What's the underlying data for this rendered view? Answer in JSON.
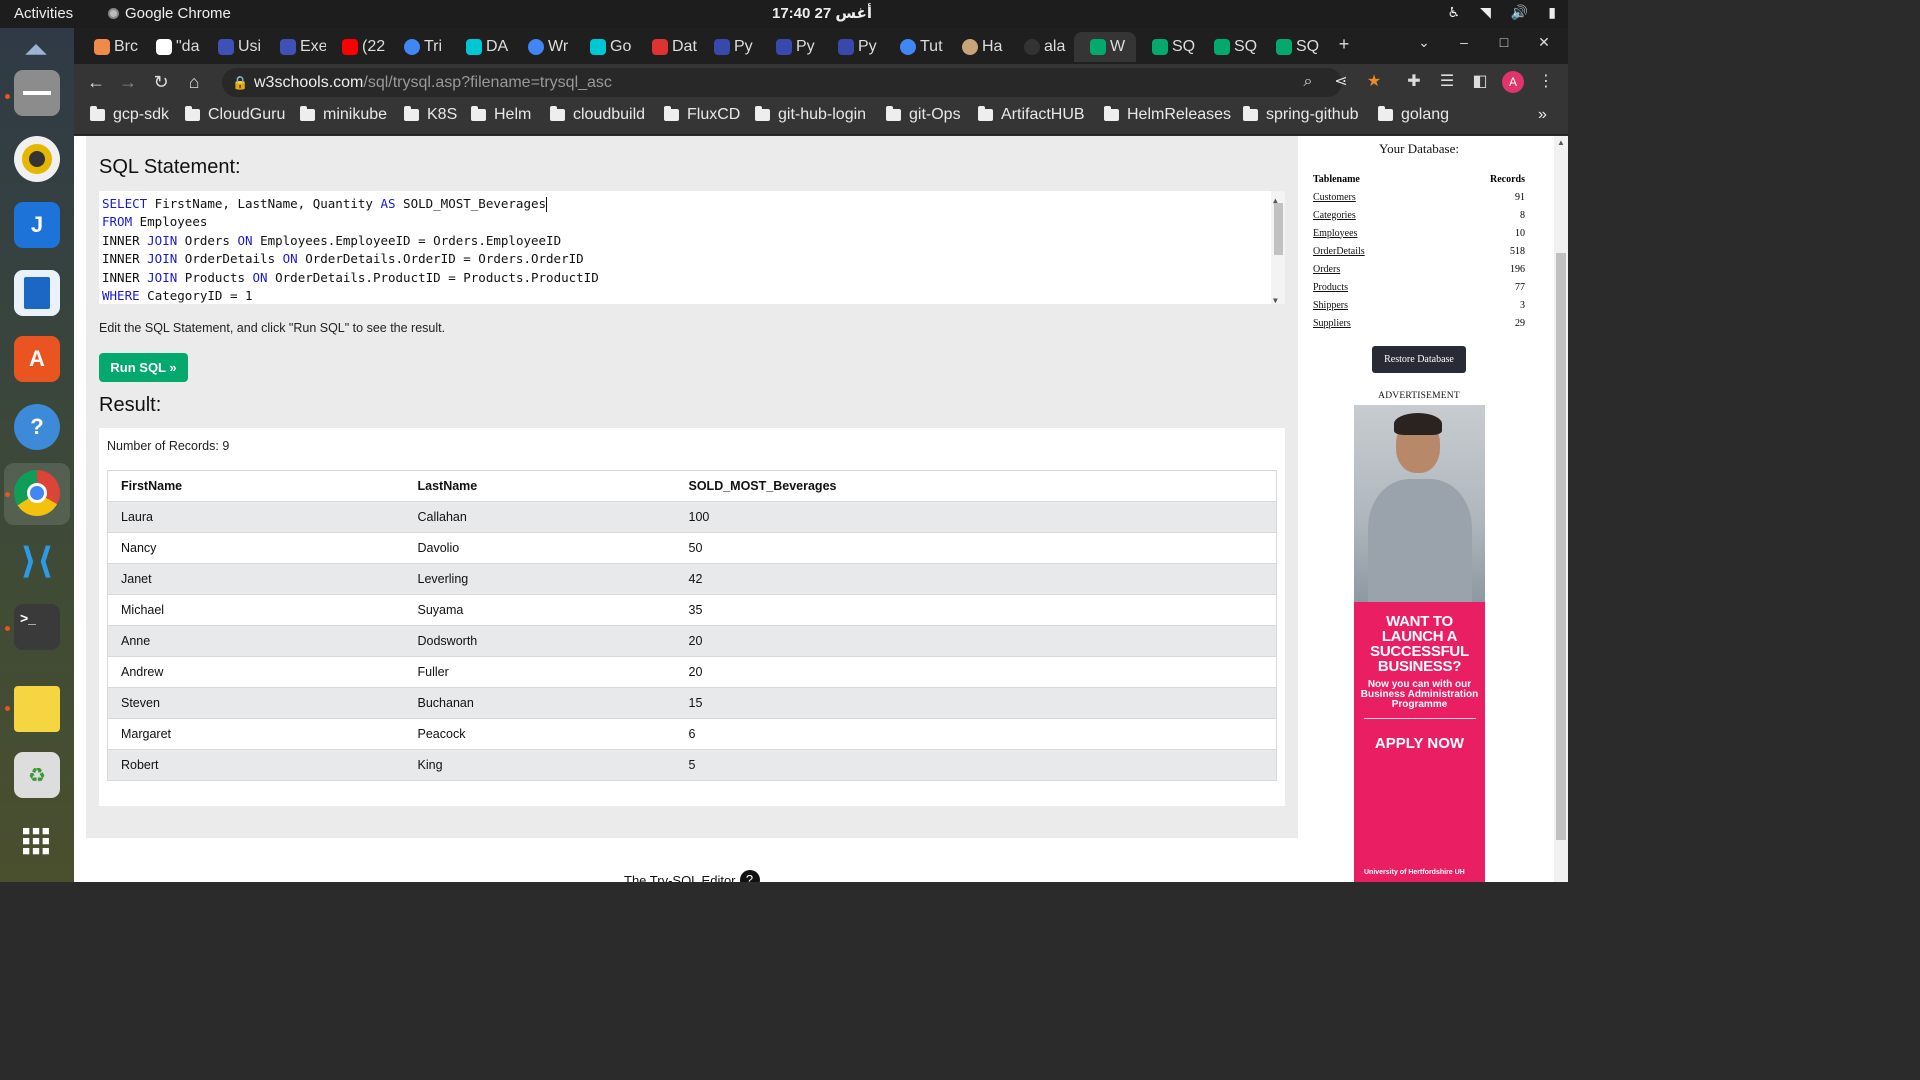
{
  "system": {
    "activities": "Activities",
    "app_name": "Google Chrome",
    "clock": "17:40  27 أغس",
    "tray_icons": [
      "accessibility-icon",
      "wifi-icon",
      "volume-icon",
      "battery-icon"
    ]
  },
  "dock": {
    "apps": [
      "ubuntu-logo",
      "files",
      "rhythmbox",
      "joplin",
      "libreoffice-writer",
      "app-center",
      "help",
      "google-chrome",
      "vs-code",
      "terminal",
      "sticky-notes",
      "trash",
      "show-apps"
    ]
  },
  "browser": {
    "tabs": [
      "Brc",
      "\"da",
      "Usi",
      "Exe",
      "(22",
      "Tri",
      "DA",
      "Wr",
      "Go",
      "Dat",
      "Py",
      "Py",
      "Py",
      "Tut",
      "Ha",
      "ala",
      "W",
      "SQ",
      "SQ",
      "SQ"
    ],
    "new_tab": "+",
    "url_host": "w3schools.com",
    "url_path": "/sql/trysql.asp?filename=trysql_asc",
    "avatar_letter": "A",
    "bookmarks": [
      "gcp-sdk",
      "CloudGuru",
      "minikube",
      "K8S",
      "Helm",
      "cloudbuild",
      "FluxCD",
      "git-hub-login",
      "git-Ops",
      "ArtifactHUB",
      "HelmReleases",
      "spring-github",
      "golang"
    ],
    "bookmarks_more": "»"
  },
  "editor": {
    "heading": "SQL Statement:",
    "lines": [
      {
        "kw": "SELECT",
        "rest": " FirstName, LastName, Quantity "
      },
      {
        "kw": "FROM",
        "rest": " Employees"
      },
      {
        "pre": "INNER ",
        "kw": "JOIN",
        "rest": " Orders "
      },
      {
        "pre": "INNER ",
        "kw": "JOIN",
        "rest": " OrderDetails "
      },
      {
        "pre": "INNER ",
        "kw": "JOIN",
        "rest": " Products "
      },
      {
        "kw": "WHERE",
        "rest": " CategoryID = 1"
      }
    ],
    "line1_as": "AS",
    "line1_tail": " SOLD_MOST_Beverages",
    "on_kw": "ON",
    "on_tails": [
      " Employees.EmployeeID = Orders.EmployeeID",
      " OrderDetails.OrderID = Orders.OrderID",
      " OrderDetails.ProductID = Products.ProductID"
    ],
    "hint": "Edit the SQL Statement, and click \"Run SQL\" to see the result.",
    "run_label": "Run SQL »"
  },
  "result": {
    "heading": "Result:",
    "count_text": "Number of Records: 9",
    "columns": [
      "FirstName",
      "LastName",
      "SOLD_MOST_Beverages"
    ],
    "rows": [
      [
        "Laura",
        "Callahan",
        "100"
      ],
      [
        "Nancy",
        "Davolio",
        "50"
      ],
      [
        "Janet",
        "Leverling",
        "42"
      ],
      [
        "Michael",
        "Suyama",
        "35"
      ],
      [
        "Anne",
        "Dodsworth",
        "20"
      ],
      [
        "Andrew",
        "Fuller",
        "20"
      ],
      [
        "Steven",
        "Buchanan",
        "15"
      ],
      [
        "Margaret",
        "Peacock",
        "6"
      ],
      [
        "Robert",
        "King",
        "5"
      ]
    ]
  },
  "footer": {
    "text": "The Try-SQL Editor",
    "help_glyph": "?"
  },
  "database": {
    "title": "Your Database:",
    "col_table": "Tablename",
    "col_records": "Records",
    "tables": [
      {
        "name": "Customers",
        "records": "91"
      },
      {
        "name": "Categories",
        "records": "8"
      },
      {
        "name": "Employees",
        "records": "10"
      },
      {
        "name": "OrderDetails",
        "records": "518"
      },
      {
        "name": "Orders",
        "records": "196"
      },
      {
        "name": "Products",
        "records": "77"
      },
      {
        "name": "Shippers",
        "records": "3"
      },
      {
        "name": "Suppliers",
        "records": "29"
      }
    ],
    "restore_label": "Restore Database"
  },
  "ad": {
    "label": "ADVERTISEMENT",
    "headline": "WANT TO LAUNCH A SUCCESSFUL BUSINESS?",
    "sub": "Now you can with our Business Administration Programme",
    "cta": "APPLY NOW",
    "brand": "University of Hertfordshire UH",
    "accent": "#ea1e63"
  },
  "colors": {
    "run_button": "#04aa6d",
    "sql_keyword": "#1a1ad6",
    "striped_row": "#e7e9eb",
    "restore_button": "#282a35"
  }
}
